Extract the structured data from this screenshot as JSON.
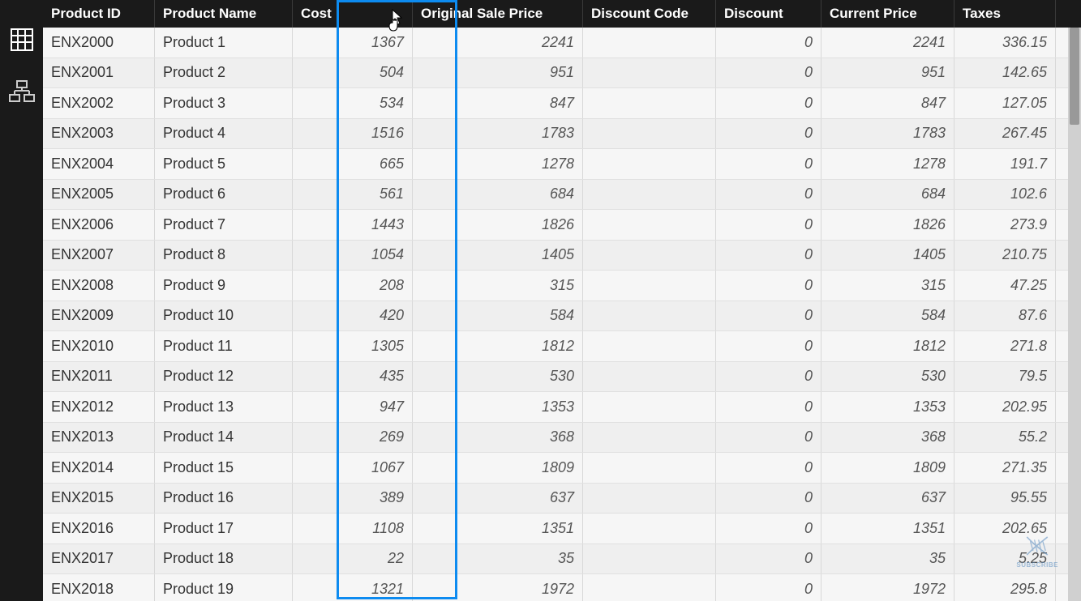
{
  "sidebar": {
    "items": [
      {
        "name": "data-view-icon"
      },
      {
        "name": "model-view-icon"
      }
    ]
  },
  "table": {
    "columns": [
      {
        "key": "productId",
        "label": "Product ID",
        "cls": "col-productid",
        "num": false
      },
      {
        "key": "productName",
        "label": "Product Name",
        "cls": "col-productname",
        "num": false
      },
      {
        "key": "cost",
        "label": "Cost",
        "cls": "col-cost",
        "num": true
      },
      {
        "key": "originalSalePrice",
        "label": "Original Sale Price",
        "cls": "col-originalsaleprice",
        "num": true
      },
      {
        "key": "discountCode",
        "label": "Discount Code",
        "cls": "col-discountcode",
        "num": false
      },
      {
        "key": "discount",
        "label": "Discount",
        "cls": "col-discount",
        "num": true
      },
      {
        "key": "currentPrice",
        "label": "Current Price",
        "cls": "col-currentprice",
        "num": true
      },
      {
        "key": "taxes",
        "label": "Taxes",
        "cls": "col-taxes",
        "num": true
      }
    ],
    "rows": [
      {
        "productId": "ENX2000",
        "productName": "Product 1",
        "cost": "1367",
        "originalSalePrice": "2241",
        "discountCode": "",
        "discount": "0",
        "currentPrice": "2241",
        "taxes": "336.15"
      },
      {
        "productId": "ENX2001",
        "productName": "Product 2",
        "cost": "504",
        "originalSalePrice": "951",
        "discountCode": "",
        "discount": "0",
        "currentPrice": "951",
        "taxes": "142.65"
      },
      {
        "productId": "ENX2002",
        "productName": "Product 3",
        "cost": "534",
        "originalSalePrice": "847",
        "discountCode": "",
        "discount": "0",
        "currentPrice": "847",
        "taxes": "127.05"
      },
      {
        "productId": "ENX2003",
        "productName": "Product 4",
        "cost": "1516",
        "originalSalePrice": "1783",
        "discountCode": "",
        "discount": "0",
        "currentPrice": "1783",
        "taxes": "267.45"
      },
      {
        "productId": "ENX2004",
        "productName": "Product 5",
        "cost": "665",
        "originalSalePrice": "1278",
        "discountCode": "",
        "discount": "0",
        "currentPrice": "1278",
        "taxes": "191.7"
      },
      {
        "productId": "ENX2005",
        "productName": "Product 6",
        "cost": "561",
        "originalSalePrice": "684",
        "discountCode": "",
        "discount": "0",
        "currentPrice": "684",
        "taxes": "102.6"
      },
      {
        "productId": "ENX2006",
        "productName": "Product 7",
        "cost": "1443",
        "originalSalePrice": "1826",
        "discountCode": "",
        "discount": "0",
        "currentPrice": "1826",
        "taxes": "273.9"
      },
      {
        "productId": "ENX2007",
        "productName": "Product 8",
        "cost": "1054",
        "originalSalePrice": "1405",
        "discountCode": "",
        "discount": "0",
        "currentPrice": "1405",
        "taxes": "210.75"
      },
      {
        "productId": "ENX2008",
        "productName": "Product 9",
        "cost": "208",
        "originalSalePrice": "315",
        "discountCode": "",
        "discount": "0",
        "currentPrice": "315",
        "taxes": "47.25"
      },
      {
        "productId": "ENX2009",
        "productName": "Product 10",
        "cost": "420",
        "originalSalePrice": "584",
        "discountCode": "",
        "discount": "0",
        "currentPrice": "584",
        "taxes": "87.6"
      },
      {
        "productId": "ENX2010",
        "productName": "Product 11",
        "cost": "1305",
        "originalSalePrice": "1812",
        "discountCode": "",
        "discount": "0",
        "currentPrice": "1812",
        "taxes": "271.8"
      },
      {
        "productId": "ENX2011",
        "productName": "Product 12",
        "cost": "435",
        "originalSalePrice": "530",
        "discountCode": "",
        "discount": "0",
        "currentPrice": "530",
        "taxes": "79.5"
      },
      {
        "productId": "ENX2012",
        "productName": "Product 13",
        "cost": "947",
        "originalSalePrice": "1353",
        "discountCode": "",
        "discount": "0",
        "currentPrice": "1353",
        "taxes": "202.95"
      },
      {
        "productId": "ENX2013",
        "productName": "Product 14",
        "cost": "269",
        "originalSalePrice": "368",
        "discountCode": "",
        "discount": "0",
        "currentPrice": "368",
        "taxes": "55.2"
      },
      {
        "productId": "ENX2014",
        "productName": "Product 15",
        "cost": "1067",
        "originalSalePrice": "1809",
        "discountCode": "",
        "discount": "0",
        "currentPrice": "1809",
        "taxes": "271.35"
      },
      {
        "productId": "ENX2015",
        "productName": "Product 16",
        "cost": "389",
        "originalSalePrice": "637",
        "discountCode": "",
        "discount": "0",
        "currentPrice": "637",
        "taxes": "95.55"
      },
      {
        "productId": "ENX2016",
        "productName": "Product 17",
        "cost": "1108",
        "originalSalePrice": "1351",
        "discountCode": "",
        "discount": "0",
        "currentPrice": "1351",
        "taxes": "202.65"
      },
      {
        "productId": "ENX2017",
        "productName": "Product 18",
        "cost": "22",
        "originalSalePrice": "35",
        "discountCode": "",
        "discount": "0",
        "currentPrice": "35",
        "taxes": "5.25"
      },
      {
        "productId": "ENX2018",
        "productName": "Product 19",
        "cost": "1321",
        "originalSalePrice": "1972",
        "discountCode": "",
        "discount": "0",
        "currentPrice": "1972",
        "taxes": "295.8"
      }
    ]
  },
  "watermark": {
    "text": "SUBSCRIBE"
  },
  "selectedColumn": "cost"
}
